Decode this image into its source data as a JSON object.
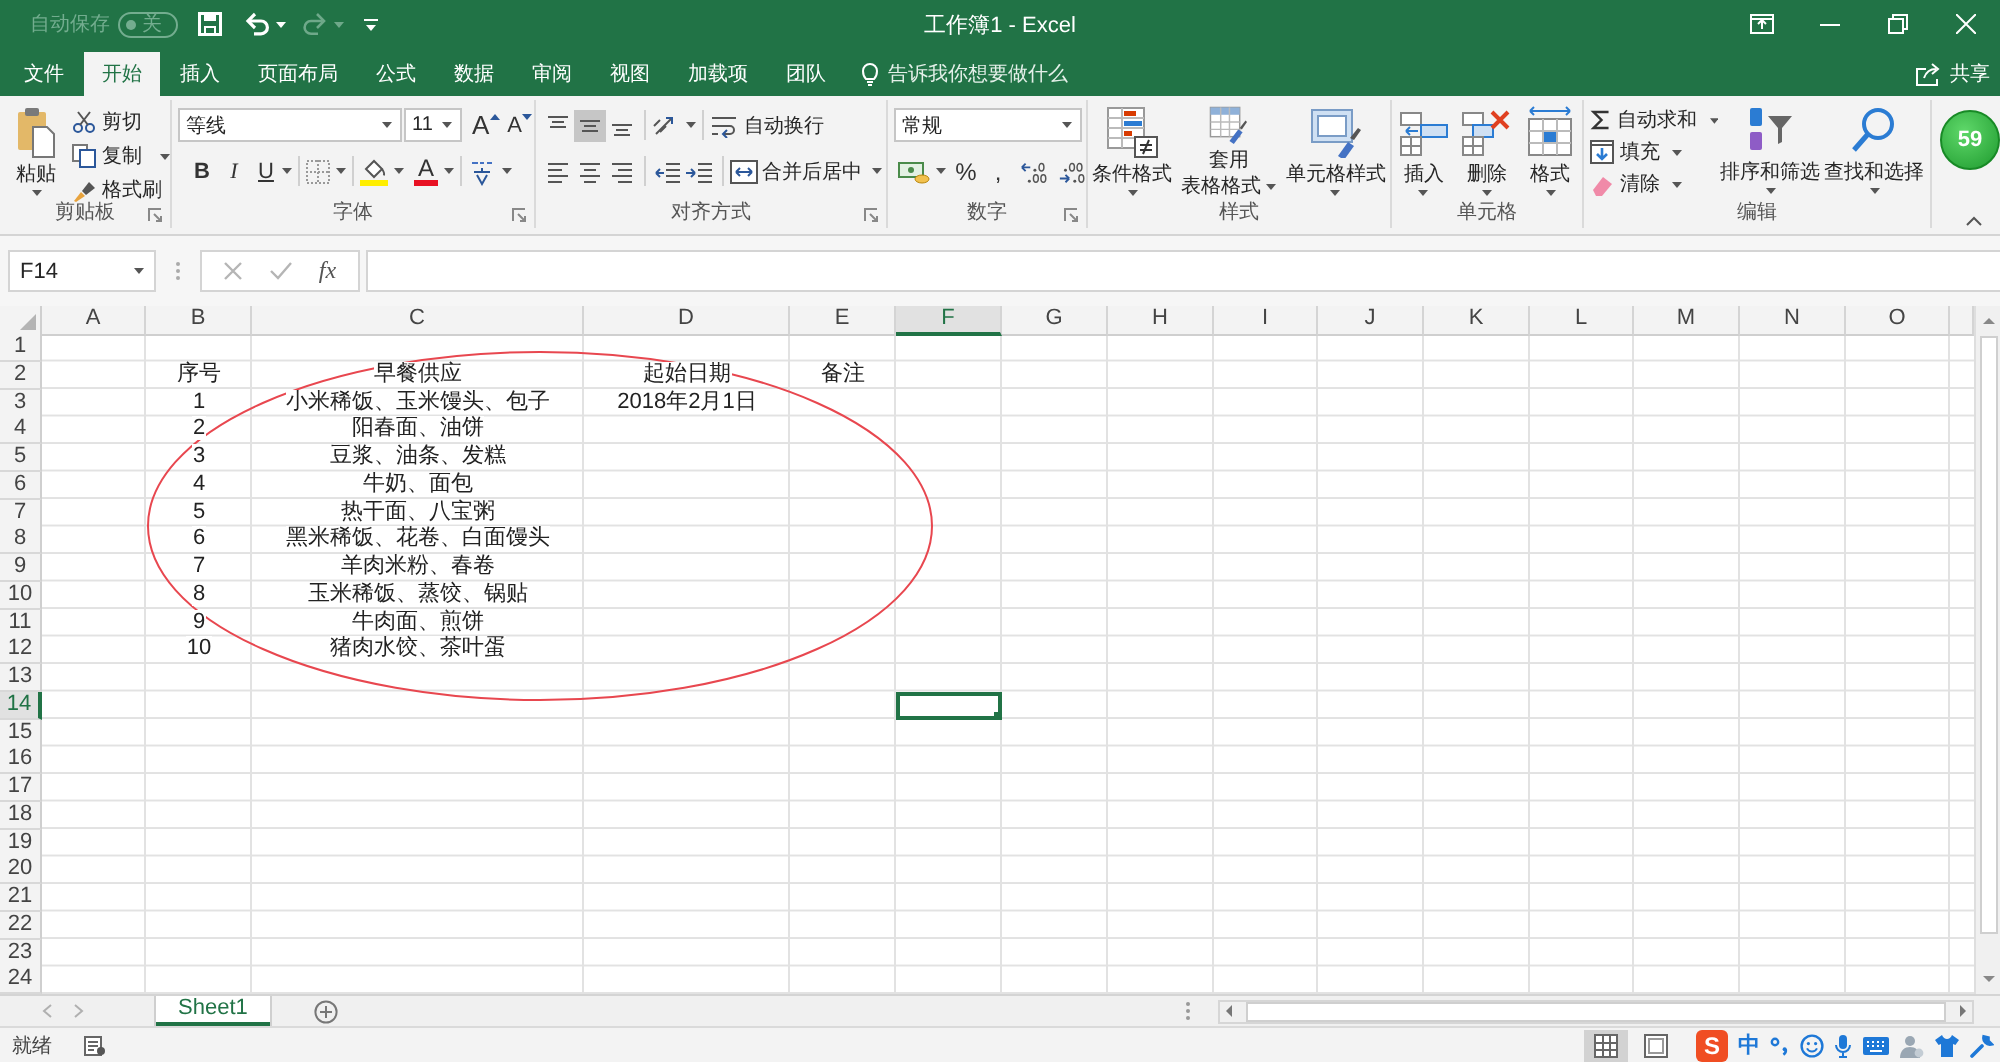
{
  "title_bar": {
    "autosave": {
      "label": "自动保存",
      "toggle": "关",
      "on": false
    },
    "quick_access": [
      {
        "kind": "save",
        "disabled": false
      },
      {
        "kind": "undo",
        "disabled": false
      },
      {
        "kind": "redo",
        "disabled": true
      },
      {
        "kind": "customize",
        "disabled": false
      }
    ],
    "title": "工作簿1 - Excel"
  },
  "tabs": [
    {
      "label": "文件",
      "selected": false
    },
    {
      "label": "开始",
      "selected": true
    },
    {
      "label": "插入",
      "selected": false
    },
    {
      "label": "页面布局",
      "selected": false
    },
    {
      "label": "公式",
      "selected": false
    },
    {
      "label": "数据",
      "selected": false
    },
    {
      "label": "审阅",
      "selected": false
    },
    {
      "label": "视图",
      "selected": false
    },
    {
      "label": "加载项",
      "selected": false
    },
    {
      "label": "团队",
      "selected": false
    }
  ],
  "tell_me": {
    "placeholder": "告诉我你想要做什么"
  },
  "share": {
    "label": "共享"
  },
  "ribbon": {
    "clipboard": {
      "label": "剪贴板",
      "paste": "粘贴",
      "cut": "剪切",
      "copy": "复制",
      "format_painter": "格式刷"
    },
    "font": {
      "label": "字体",
      "font_name": "等线",
      "font_size": "11",
      "grow": "A",
      "shrink": "A",
      "styles": [
        {
          "kind": "bold",
          "label": "B"
        },
        {
          "kind": "italic",
          "label": "I"
        },
        {
          "kind": "underline",
          "label": "U"
        }
      ],
      "font_color": "A"
    },
    "alignment": {
      "label": "对齐方式",
      "vertical": [
        {
          "kind": "top",
          "selected": false
        },
        {
          "kind": "middle",
          "selected": true
        },
        {
          "kind": "bottom",
          "selected": false
        }
      ],
      "wrap_text": "自动换行",
      "merge_center": "合并后居中"
    },
    "number": {
      "label": "数字",
      "format": "常规",
      "percent": "%",
      "comma": ","
    },
    "styles": {
      "label": "样式",
      "buttons": [
        {
          "kind": "conditional",
          "lines": [
            "条件格式"
          ]
        },
        {
          "kind": "table",
          "lines": [
            "套用",
            "表格格式"
          ]
        },
        {
          "kind": "cell",
          "lines": [
            "单元格样式"
          ]
        }
      ]
    },
    "cells": {
      "label": "单元格",
      "buttons": [
        {
          "kind": "insert",
          "label": "插入"
        },
        {
          "kind": "delete",
          "label": "删除"
        },
        {
          "kind": "format",
          "label": "格式"
        }
      ]
    },
    "editing": {
      "label": "编辑",
      "autosum": "自动求和",
      "fill": "填充",
      "clear": "清除",
      "sort_filter": "排序和筛选",
      "find_select": "查找和选择"
    }
  },
  "floating_badge": {
    "text": "59"
  },
  "formula_bar": {
    "name_box": "F14",
    "function_label": "fx"
  },
  "grid": {
    "columns": [
      {
        "label": "A",
        "selected": false
      },
      {
        "label": "B",
        "selected": false
      },
      {
        "label": "C",
        "selected": false
      },
      {
        "label": "D",
        "selected": false
      },
      {
        "label": "E",
        "selected": false
      },
      {
        "label": "F",
        "selected": true
      },
      {
        "label": "G",
        "selected": false
      },
      {
        "label": "H",
        "selected": false
      },
      {
        "label": "I",
        "selected": false
      },
      {
        "label": "J",
        "selected": false
      },
      {
        "label": "K",
        "selected": false
      },
      {
        "label": "L",
        "selected": false
      },
      {
        "label": "M",
        "selected": false
      },
      {
        "label": "N",
        "selected": false
      },
      {
        "label": "O",
        "selected": false
      }
    ],
    "rows": [
      {
        "label": "1",
        "selected": false
      },
      {
        "label": "2",
        "selected": false,
        "cells": [
          "序号",
          "早餐供应",
          "起始日期",
          "备注"
        ]
      },
      {
        "label": "3",
        "selected": false,
        "cells": [
          "1",
          "小米稀饭、玉米馒头、包子",
          "2018年2月1日"
        ]
      },
      {
        "label": "4",
        "selected": false,
        "cells": [
          "2",
          "阳春面、油饼"
        ]
      },
      {
        "label": "5",
        "selected": false,
        "cells": [
          "3",
          "豆浆、油条、发糕"
        ]
      },
      {
        "label": "6",
        "selected": false,
        "cells": [
          "4",
          "牛奶、面包"
        ]
      },
      {
        "label": "7",
        "selected": false,
        "cells": [
          "5",
          "热干面、八宝粥"
        ]
      },
      {
        "label": "8",
        "selected": false,
        "cells": [
          "6",
          "黑米稀饭、花卷、白面馒头"
        ]
      },
      {
        "label": "9",
        "selected": false,
        "cells": [
          "7",
          "羊肉米粉、春卷"
        ]
      },
      {
        "label": "10",
        "selected": false,
        "cells": [
          "8",
          "玉米稀饭、蒸饺、锅贴"
        ]
      },
      {
        "label": "11",
        "selected": false,
        "cells": [
          "9",
          "牛肉面、煎饼"
        ]
      },
      {
        "label": "12",
        "selected": false,
        "cells": [
          "10",
          "猪肉水饺、茶叶蛋"
        ]
      },
      {
        "label": "13",
        "selected": false
      },
      {
        "label": "14",
        "selected": true
      },
      {
        "label": "15",
        "selected": false
      },
      {
        "label": "16",
        "selected": false
      },
      {
        "label": "17",
        "selected": false
      },
      {
        "label": "18",
        "selected": false
      },
      {
        "label": "19",
        "selected": false
      },
      {
        "label": "20",
        "selected": false
      },
      {
        "label": "21",
        "selected": false
      },
      {
        "label": "22",
        "selected": false
      },
      {
        "label": "23",
        "selected": false
      },
      {
        "label": "24",
        "selected": false
      }
    ]
  },
  "annotations": [
    {
      "kind": "ellipse"
    }
  ],
  "sheet_tabs": [
    {
      "label": "Sheet1",
      "selected": true
    }
  ],
  "status_bar": {
    "status": "就绪",
    "views": [
      {
        "kind": "normal",
        "selected": true
      },
      {
        "kind": "page_layout",
        "selected": false
      }
    ],
    "ime": {
      "logo": "S",
      "mode": "中"
    }
  }
}
